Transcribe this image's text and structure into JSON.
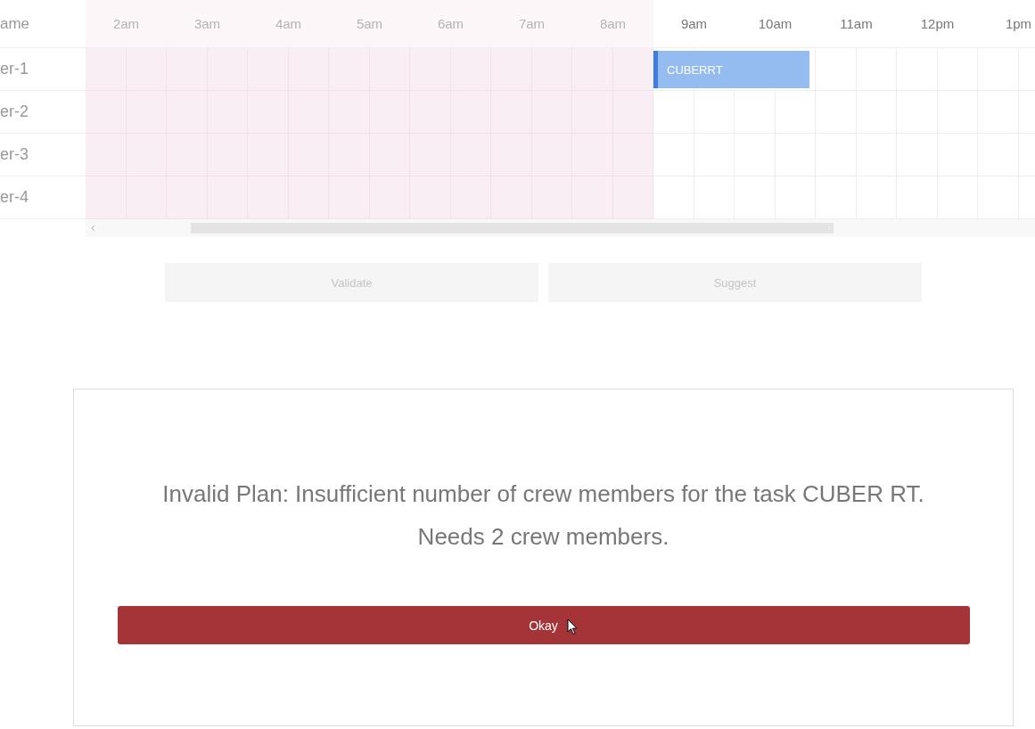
{
  "schedule": {
    "name_header": "ame",
    "hours": [
      {
        "label": "2am",
        "past": true
      },
      {
        "label": "3am",
        "past": true
      },
      {
        "label": "4am",
        "past": true
      },
      {
        "label": "5am",
        "past": true
      },
      {
        "label": "6am",
        "past": true
      },
      {
        "label": "7am",
        "past": true
      },
      {
        "label": "8am",
        "past": true
      },
      {
        "label": "9am",
        "past": false
      },
      {
        "label": "10am",
        "past": false
      },
      {
        "label": "11am",
        "past": false
      },
      {
        "label": "12pm",
        "past": false
      },
      {
        "label": "1pm",
        "past": false
      }
    ],
    "rows": [
      {
        "name": "er-1",
        "cells": [
          {
            "busy": false
          },
          {
            "busy": false
          },
          {
            "busy": false
          },
          {
            "busy": false
          },
          {
            "busy": false
          },
          {
            "busy": false
          },
          {
            "busy": false
          },
          {
            "busy": true,
            "label": "CUBERRT"
          },
          {
            "busy": true
          },
          {
            "busy": false
          },
          {
            "busy": false
          },
          {
            "busy": false
          }
        ]
      },
      {
        "name": "er-2",
        "cells": [
          {
            "busy": false
          },
          {
            "busy": false
          },
          {
            "busy": false
          },
          {
            "busy": false
          },
          {
            "busy": false
          },
          {
            "busy": false
          },
          {
            "busy": false
          },
          {
            "busy": false
          },
          {
            "busy": false
          },
          {
            "busy": false
          },
          {
            "busy": false
          },
          {
            "busy": false
          }
        ]
      },
      {
        "name": "er-3",
        "cells": [
          {
            "busy": false
          },
          {
            "busy": false
          },
          {
            "busy": false
          },
          {
            "busy": false
          },
          {
            "busy": false
          },
          {
            "busy": false
          },
          {
            "busy": false
          },
          {
            "busy": false
          },
          {
            "busy": false
          },
          {
            "busy": false
          },
          {
            "busy": false
          },
          {
            "busy": false
          }
        ]
      },
      {
        "name": "er-4",
        "cells": [
          {
            "busy": false
          },
          {
            "busy": false
          },
          {
            "busy": false
          },
          {
            "busy": false
          },
          {
            "busy": false
          },
          {
            "busy": false
          },
          {
            "busy": false
          },
          {
            "busy": false
          },
          {
            "busy": false
          },
          {
            "busy": false
          },
          {
            "busy": false
          },
          {
            "busy": false
          }
        ]
      }
    ]
  },
  "actions": [
    {
      "label": "Validate",
      "disabled": true
    },
    {
      "label": "Suggest",
      "disabled": true
    }
  ],
  "dialog": {
    "message": "Invalid Plan: Insufficient number of crew members for the task CUBER RT. Needs 2 crew members.",
    "button": "Okay"
  }
}
